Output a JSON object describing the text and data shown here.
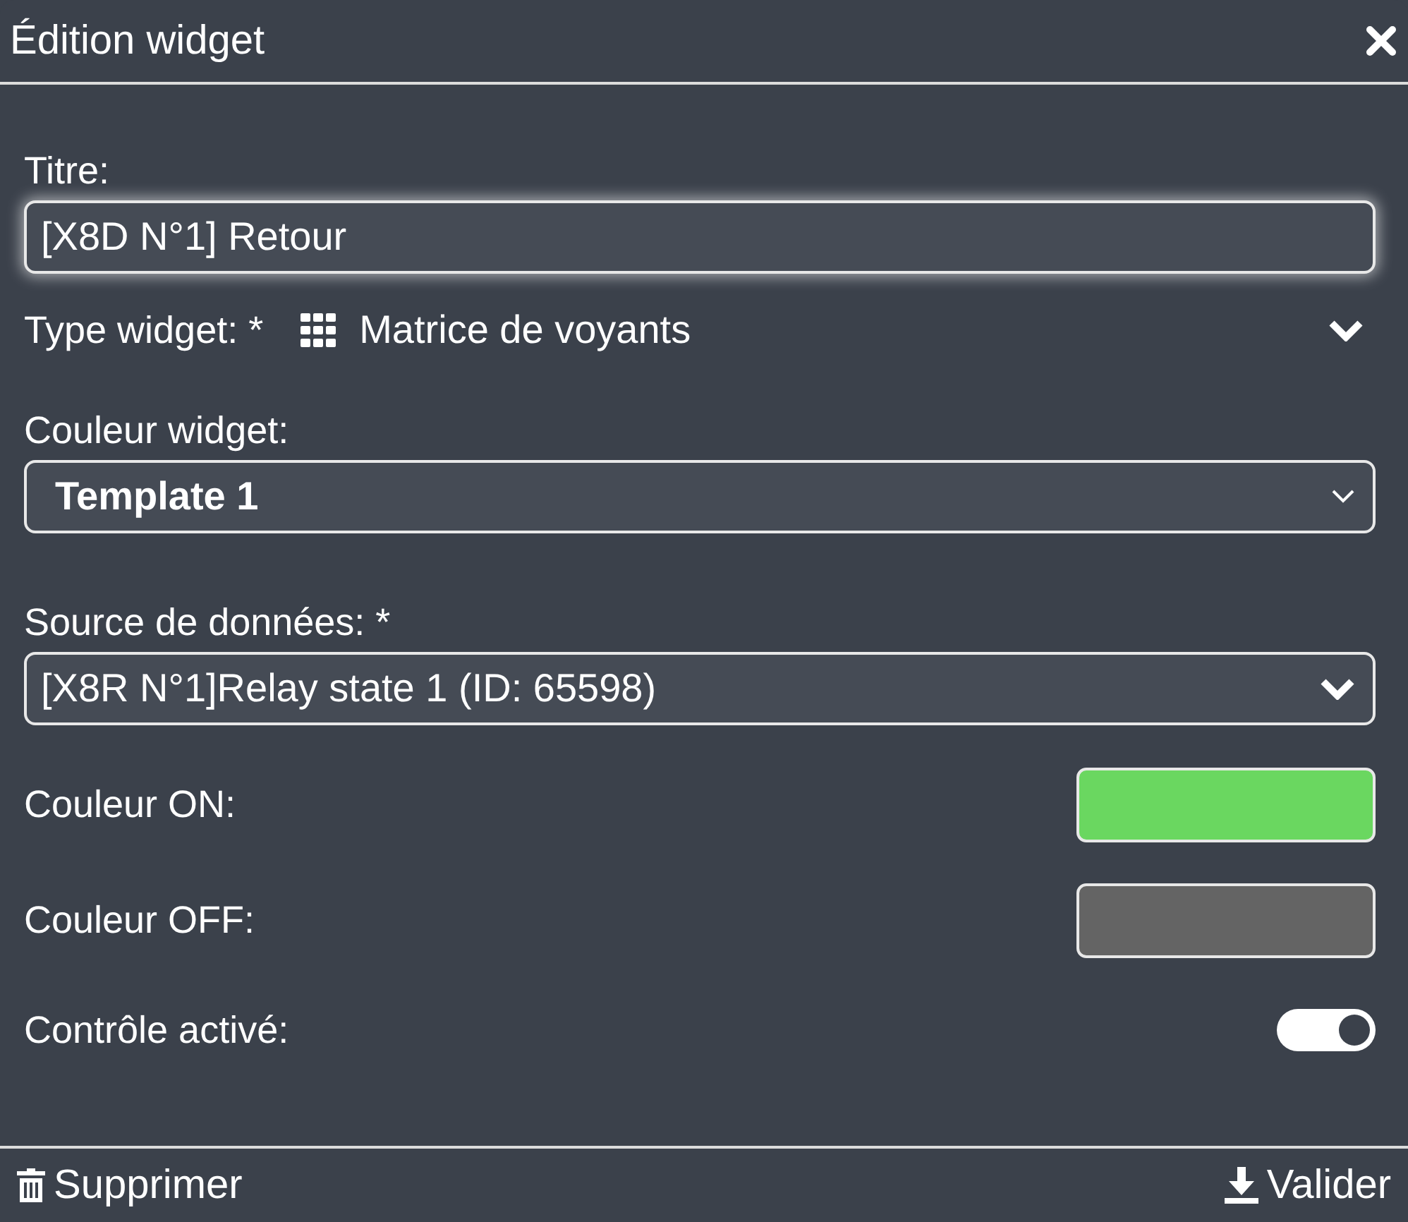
{
  "dialog": {
    "title": "Édition widget"
  },
  "fields": [
    {
      "kind": "text",
      "label": "Titre:",
      "value": "[X8D N°1] Retour",
      "focused": true
    },
    {
      "kind": "type",
      "label": "Type widget: *",
      "value": "Matrice de voyants"
    },
    {
      "kind": "native-select",
      "label": "Couleur widget:",
      "value": "Template 1"
    },
    {
      "kind": "select",
      "label": "Source de données: *",
      "value": "[X8R N°1]Relay state 1 (ID: 65598)"
    },
    {
      "kind": "color",
      "label": "Couleur ON:",
      "color": "#6ad760"
    },
    {
      "kind": "color",
      "label": "Couleur OFF:",
      "color": "#646464"
    },
    {
      "kind": "toggle",
      "label": "Contrôle activé:",
      "on": true
    }
  ],
  "footer": {
    "delete": "Supprimer",
    "submit": "Valider"
  }
}
